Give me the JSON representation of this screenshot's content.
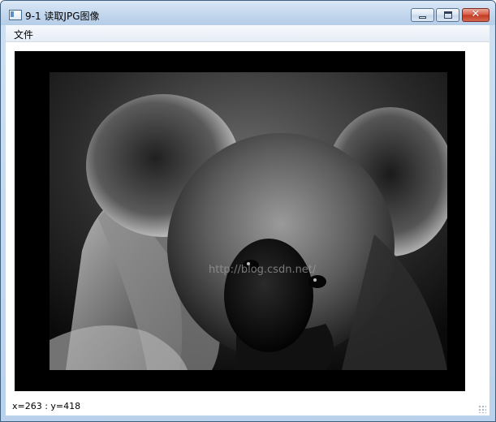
{
  "window": {
    "title": "9-1 读取JPG图像",
    "minimize_label": "",
    "maximize_label": "",
    "close_glyph": "✕"
  },
  "menu": {
    "items": [
      {
        "label": "文件"
      }
    ]
  },
  "image": {
    "watermark": "http://blog.csdn.net/"
  },
  "status": {
    "text": "x=263 : y=418"
  },
  "colors": {
    "titlebar": "#c3d7ee",
    "close_button": "#d9563f",
    "image_background": "#000000"
  },
  "icons": {
    "app": "app-window-icon",
    "minimize": "minimize-icon",
    "maximize": "maximize-icon",
    "close": "close-icon",
    "grip": "resize-grip-icon"
  }
}
